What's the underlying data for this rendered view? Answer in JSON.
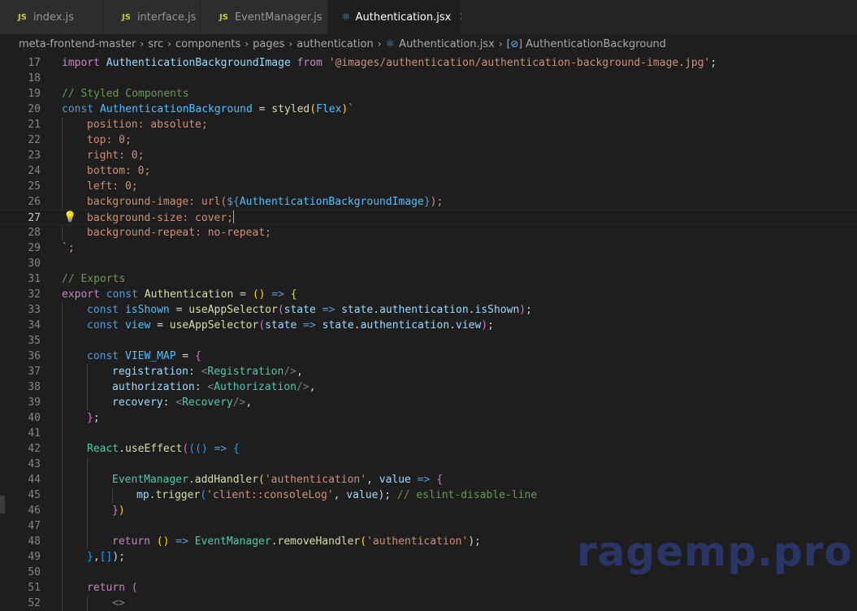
{
  "tabs": [
    {
      "icon": "JS",
      "label": "index.js",
      "active": false
    },
    {
      "icon": "JS",
      "label": "interface.js",
      "active": false
    },
    {
      "icon": "JS",
      "label": "EventManager.js",
      "active": false
    },
    {
      "icon": "react-icon",
      "label": "Authentication.jsx",
      "active": true,
      "close": "✕"
    }
  ],
  "breadcrumb": {
    "parts": [
      "meta-frontend-master",
      "src",
      "components",
      "pages",
      "authentication"
    ],
    "file": "Authentication.jsx",
    "symbol": "AuthenticationBackground"
  },
  "editor": {
    "current_line": 27,
    "lines": [
      {
        "n": "17"
      },
      {
        "n": "18"
      },
      {
        "n": "19"
      },
      {
        "n": "20"
      },
      {
        "n": "21"
      },
      {
        "n": "22"
      },
      {
        "n": "23"
      },
      {
        "n": "24"
      },
      {
        "n": "25"
      },
      {
        "n": "26"
      },
      {
        "n": "27"
      },
      {
        "n": "28"
      },
      {
        "n": "29"
      },
      {
        "n": "30"
      },
      {
        "n": "31"
      },
      {
        "n": "32"
      },
      {
        "n": "33"
      },
      {
        "n": "34"
      },
      {
        "n": "35"
      },
      {
        "n": "36"
      },
      {
        "n": "37"
      },
      {
        "n": "38"
      },
      {
        "n": "39"
      },
      {
        "n": "40"
      },
      {
        "n": "41"
      },
      {
        "n": "42"
      },
      {
        "n": "43"
      },
      {
        "n": "44"
      },
      {
        "n": "45"
      },
      {
        "n": "46"
      },
      {
        "n": "47"
      },
      {
        "n": "48"
      },
      {
        "n": "49"
      },
      {
        "n": "50"
      },
      {
        "n": "51"
      },
      {
        "n": "52"
      }
    ]
  },
  "code": {
    "l17": [
      "import",
      "AuthenticationBackgroundImage",
      "from",
      "'@images/authentication/authentication-background-image.jpg'",
      ";"
    ],
    "l19": "// Styled Components",
    "l20": [
      "const",
      "AuthenticationBackground",
      "=",
      "styled",
      "(",
      "Flex",
      ")",
      "`"
    ],
    "l21": "position: absolute;",
    "l22": "top: 0;",
    "l23": "right: 0;",
    "l24": "bottom: 0;",
    "l25": "left: 0;",
    "l26": [
      "background-image: url(",
      "${",
      "AuthenticationBackgroundImage",
      "}",
      ");"
    ],
    "l27": "background-size: cover;",
    "l28": "background-repeat: no-repeat;",
    "l29": "`;",
    "l31": "// Exports",
    "l32": [
      "export",
      "const",
      "Authentication",
      "=",
      "()",
      "=>",
      "{"
    ],
    "l33": [
      "const",
      "isShown",
      "=",
      "useAppSelector",
      "(",
      "state",
      "=>",
      "state",
      ".",
      "authentication",
      ".",
      "isShown",
      ")",
      ";"
    ],
    "l34": [
      "const",
      "view",
      "=",
      "useAppSelector",
      "(",
      "state",
      "=>",
      "state",
      ".",
      "authentication",
      ".",
      "view",
      ")",
      ";"
    ],
    "l36": [
      "const",
      "VIEW_MAP",
      "=",
      "{"
    ],
    "l37": [
      "registration",
      ": ",
      "<",
      "Registration",
      "/>",
      ","
    ],
    "l38": [
      "authorization",
      ": ",
      "<",
      "Authorization",
      "/>",
      ","
    ],
    "l39": [
      "recovery",
      ": ",
      "<",
      "Recovery",
      "/>",
      ","
    ],
    "l40": [
      "}",
      ";"
    ],
    "l42": [
      "React",
      ".",
      "useEffect",
      "(",
      "(",
      "()",
      "=>",
      "{"
    ],
    "l44": [
      "EventManager",
      ".",
      "addHandler",
      "(",
      "'authentication'",
      ", ",
      "value",
      "=>",
      "{"
    ],
    "l45": [
      "mp",
      ".",
      "trigger",
      "(",
      "'client::consoleLog'",
      ", ",
      "value",
      ");",
      "// eslint-disable-line"
    ],
    "l46": [
      "}",
      ")"
    ],
    "l48": [
      "return",
      "()",
      "=>",
      "EventManager",
      ".",
      "removeHandler",
      "(",
      "'authentication'",
      ");"
    ],
    "l49": [
      "}",
      ",",
      "[]",
      ");"
    ],
    "l51": [
      "return",
      "("
    ],
    "l52": "<>"
  },
  "watermark": "ragemp.pro",
  "colors": {
    "background": "#1e1e1e",
    "keyword": "#569cd6",
    "control": "#c586c0",
    "string": "#ce9178",
    "comment": "#6a9955",
    "function": "#dcdcaa",
    "variable": "#9cdcfe",
    "component": "#4ec9b0"
  }
}
